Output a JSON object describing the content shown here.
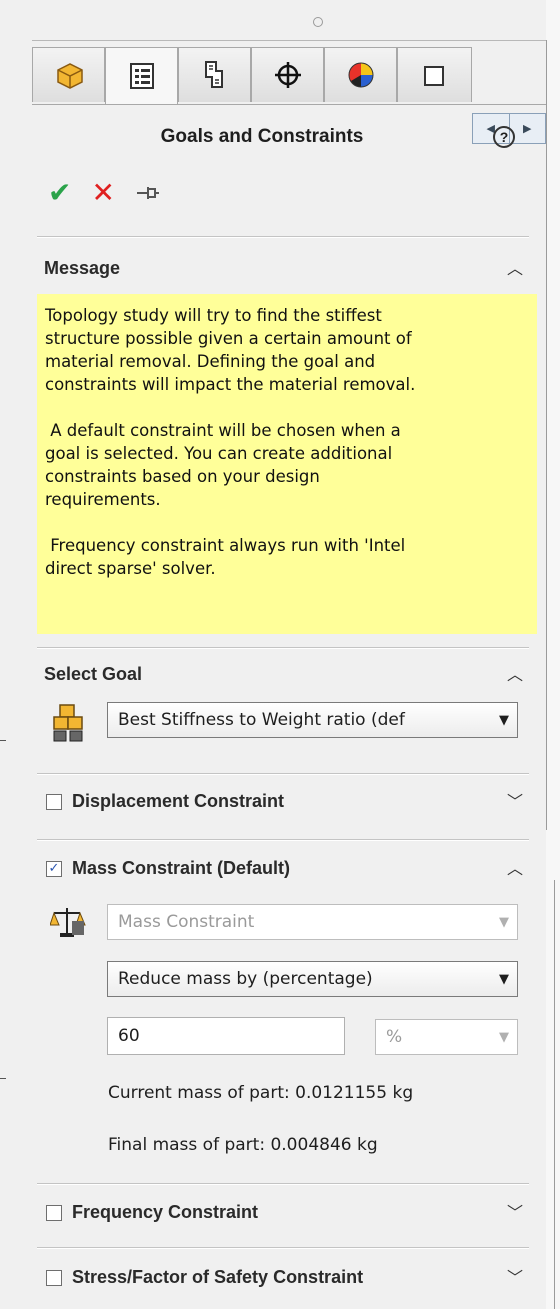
{
  "panel": {
    "title": "Goals and Constraints",
    "help_icon": "?",
    "tabs": [
      {
        "icon": "feature-manager-icon"
      },
      {
        "icon": "property-manager-icon",
        "active": true
      },
      {
        "icon": "configuration-manager-icon"
      },
      {
        "icon": "dimxpert-icon"
      },
      {
        "icon": "display-manager-icon"
      },
      {
        "icon": "partial-tab-icon"
      }
    ],
    "actions": {
      "ok_icon": "✔",
      "cancel_icon": "✕",
      "pin_icon": "⊣⊢"
    }
  },
  "message": {
    "title": "Message",
    "text": "Topology study will try to find the stiffest\nstructure possible given a certain amount of\nmaterial removal. Defining the goal and\nconstraints will impact the material removal.\n\n A default constraint will be chosen when a\ngoal is selected. You can create additional\nconstraints based on your design\nrequirements.\n\n Frequency constraint always run with 'Intel\ndirect sparse' solver."
  },
  "select_goal": {
    "title": "Select Goal",
    "value": "Best Stiffness to Weight ratio (def"
  },
  "displacement": {
    "label": "Displacement Constraint",
    "checked": false
  },
  "mass": {
    "label": "Mass Constraint (Default)",
    "checked": true,
    "type_value": "Mass Constraint",
    "method_value": "Reduce mass by (percentage)",
    "amount": "60",
    "unit": "%",
    "current_mass": "Current mass of part: 0.0121155 kg",
    "final_mass": "Final mass of part: 0.004846 kg"
  },
  "frequency": {
    "label": "Frequency Constraint",
    "checked": false
  },
  "stress": {
    "label": "Stress/Factor of Safety Constraint",
    "checked": false
  },
  "colors": {
    "message_bg": "#ffff99",
    "ok": "#2aa34a",
    "cancel": "#e02020"
  }
}
